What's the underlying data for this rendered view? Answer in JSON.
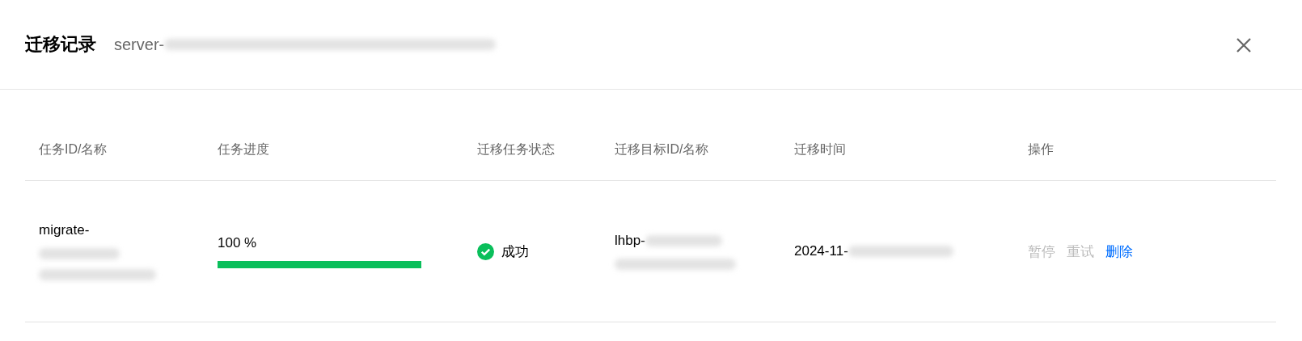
{
  "dialog": {
    "title": "迁移记录",
    "subtitle": "server-"
  },
  "table": {
    "columns": [
      "任务ID/名称",
      "任务进度",
      "迁移任务状态",
      "迁移目标ID/名称",
      "迁移时间",
      "操作"
    ],
    "rows": [
      {
        "task_id": "migrate-",
        "progress_text": "100 %",
        "level": 1,
        "status": "成功",
        "kind": "success",
        "target_id": "lhbp-",
        "time": "2024-11-",
        "actions": [
          {
            "label": "暂停",
            "disabled": true
          },
          {
            "label": "重试",
            "disabled": true
          },
          {
            "label": "删除",
            "disabled": false
          }
        ]
      }
    ]
  }
}
